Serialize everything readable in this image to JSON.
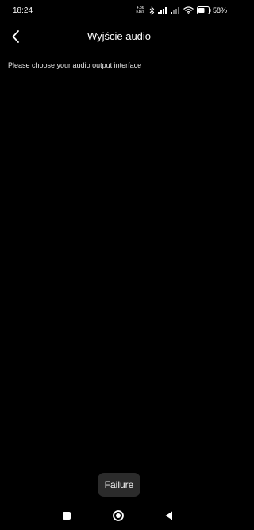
{
  "status_bar": {
    "time": "18:24",
    "net_speed_value": "4.86",
    "net_speed_unit": "KB/s",
    "battery_percent": "58%",
    "icons": [
      "bluetooth-icon",
      "signal-icon",
      "signal-icon",
      "wifi-icon",
      "battery-icon"
    ]
  },
  "header": {
    "title": "Wyjście audio",
    "back_icon": "back-chevron-icon"
  },
  "content": {
    "instruction": "Please choose your audio output interface"
  },
  "toast": {
    "message": "Failure"
  },
  "nav_bar": {
    "icons": [
      "recents-icon",
      "home-icon",
      "back-icon"
    ]
  },
  "colors": {
    "background": "#000000",
    "text": "#ffffff",
    "toast_background": "#2b2b2b"
  }
}
